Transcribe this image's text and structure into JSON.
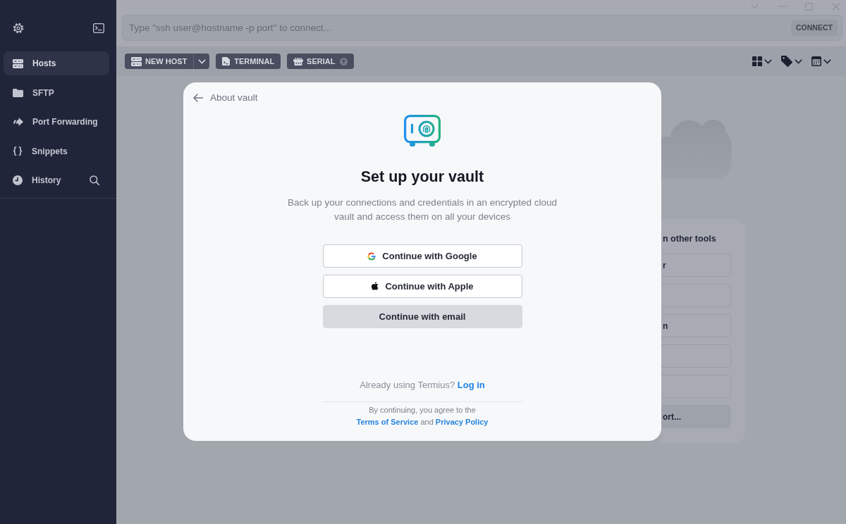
{
  "sidebar": {
    "items": [
      {
        "label": "Hosts",
        "selected": true
      },
      {
        "label": "SFTP",
        "selected": false
      },
      {
        "label": "Port Forwarding",
        "selected": false
      },
      {
        "label": "Snippets",
        "selected": false
      },
      {
        "label": "History",
        "selected": false
      }
    ]
  },
  "address_bar": {
    "placeholder": "Type \"ssh user@hostname -p port\" to connect...",
    "connect_button": {
      "label": "CONNECT",
      "disabled": true
    }
  },
  "toolbar": {
    "buttons": [
      {
        "label": "NEW HOST",
        "kind": "split"
      },
      {
        "label": "TERMINAL",
        "kind": "plain"
      },
      {
        "label": "SERIAL",
        "kind": "upgrade"
      }
    ]
  },
  "import_panel": {
    "title": "n other tools",
    "buttons": [
      {
        "kind": "outline",
        "label": "r"
      },
      {
        "kind": "outline"
      },
      {
        "kind": "outline",
        "label": "n"
      },
      {
        "kind": "outline"
      },
      {
        "kind": "outline"
      },
      {
        "kind": "filled",
        "label": "ort..."
      }
    ]
  },
  "vault_dialog": {
    "back_label": "About vault",
    "title": "Set up your vault",
    "description": "Back up your connections and credentials in an encrypted cloud vault and access them on all your devices",
    "buttons": [
      {
        "label": "Continue with Google",
        "kind": "google"
      },
      {
        "label": "Continue with Apple",
        "kind": "apple"
      },
      {
        "label": "Continue with email",
        "kind": "email"
      }
    ],
    "login_prompt": "Already using Termius?",
    "login_link": "Log in",
    "terms_prefix": "By continuing, you agree to the",
    "terms_link": "Terms of Service",
    "terms_joiner": "and",
    "privacy_link": "Privacy Policy"
  }
}
